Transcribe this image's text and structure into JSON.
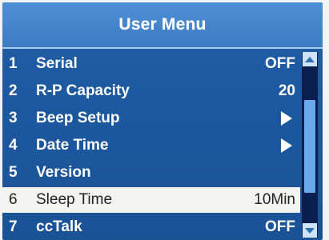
{
  "title": "User Menu",
  "colors": {
    "screen_bg": "#1f5ea6",
    "title_bar": "#4f8fd4",
    "selected_row": "#f3f3f1",
    "scrollbar_track": "#0b1f4f",
    "scrollbar_thumb": "#67a9ea"
  },
  "menu": {
    "items": [
      {
        "num": "1",
        "label": "Serial",
        "value": "OFF"
      },
      {
        "num": "2",
        "label": "R-P Capacity",
        "value": "20"
      },
      {
        "num": "3",
        "label": "Beep Setup",
        "icon": "arrow-right-icon"
      },
      {
        "num": "4",
        "label": "Date Time",
        "icon": "arrow-right-icon"
      },
      {
        "num": "5",
        "label": "Version",
        "value": ""
      },
      {
        "num": "6",
        "label": "Sleep Time",
        "value": "10Min",
        "selected": true
      },
      {
        "num": "7",
        "label": "ccTalk",
        "value": "OFF"
      }
    ],
    "selected_index": 5
  },
  "scrollbar": {
    "up_icon": "scroll-up-arrow-icon",
    "down_icon": "scroll-down-arrow-icon"
  }
}
